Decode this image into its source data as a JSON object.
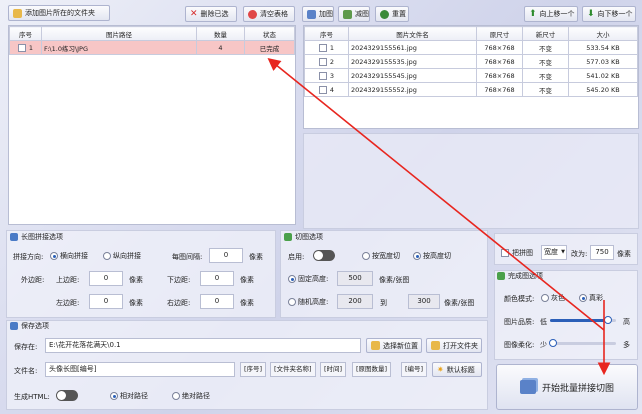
{
  "toolbar": {
    "add_folder": "添加图片所在的文件夹",
    "delete_selected": "删除已选",
    "clear_table": "清空表格",
    "add_image": "加图",
    "remove_image": "减图",
    "reset": "重置",
    "move_up": "向上移一个",
    "move_down": "向下移一个"
  },
  "left_table": {
    "headers": [
      "序号",
      "图片路径",
      "数量",
      "状态"
    ],
    "rows": [
      {
        "index": "1",
        "path": "F:\\1.0练习\\JPG",
        "count": "4",
        "status": "已完成"
      }
    ]
  },
  "right_table": {
    "headers": [
      "序号",
      "图片文件名",
      "原尺寸",
      "新尺寸",
      "大小"
    ],
    "rows": [
      {
        "index": "1",
        "name": "2024329155561.jpg",
        "orig": "768×768",
        "new": "不变",
        "size": "533.54 KB"
      },
      {
        "index": "2",
        "name": "2024329155535.jpg",
        "orig": "768×768",
        "new": "不变",
        "size": "577.03 KB"
      },
      {
        "index": "3",
        "name": "2024329155545.jpg",
        "orig": "768×768",
        "new": "不变",
        "size": "541.02 KB"
      },
      {
        "index": "4",
        "name": "2024329155552.jpg",
        "orig": "768×768",
        "new": "不变",
        "size": "545.20 KB"
      }
    ]
  },
  "stitch": {
    "title": "长图拼接选项",
    "direction_label": "拼接方向:",
    "horizontal": "横向拼接",
    "vertical": "纵向拼接",
    "gap_label": "每图间隔:",
    "gap_value": "0",
    "px": "像素",
    "margin_label": "外边距:",
    "top_label": "上边距:",
    "top_value": "0",
    "bottom_label": "下边距:",
    "bottom_value": "0",
    "left_label": "左边距:",
    "left_value": "0",
    "right_label": "右边距:",
    "right_value": "0"
  },
  "cut": {
    "title": "切图选项",
    "enable_label": "启用:",
    "by_width": "按宽度切",
    "by_height": "按高度切",
    "fixed_height": "固定高度:",
    "fixed_value": "500",
    "unit": "像素/张图",
    "random_height": "随机高度:",
    "random_from": "200",
    "to": "到",
    "random_to": "300"
  },
  "resize": {
    "label": "把拼图",
    "select": "宽度",
    "change_to": "改为:",
    "value": "750",
    "px": "像素"
  },
  "finish": {
    "title": "完成图选项",
    "color_label": "颜色模式:",
    "grey": "灰色",
    "color": "真彩",
    "quality_label": "图片品质:",
    "low": "低",
    "high": "高",
    "quality_level": 0.88,
    "soften_label": "图像柔化:",
    "less": "少",
    "more": "多",
    "soften_level": 0.0
  },
  "save": {
    "title": "保存选项",
    "save_to_label": "保存在:",
    "save_path": "E:\\花开花落花满天\\0.1",
    "choose_button": "选择新位置",
    "open_folder_button": "打开文件夹",
    "filename_label": "文件名:",
    "filename_value": "头像长图[编号]",
    "tags": [
      "[序号]",
      "[文件夹名称]",
      "[时间]",
      "[原图数量]",
      "[编号]"
    ],
    "default_button": "默认标题",
    "html_label": "生成HTML:",
    "relative": "相对路径",
    "absolute": "绝对路径"
  },
  "start_button": "开始批量拼接切图",
  "colors": {
    "arrow": "#e8261f",
    "selected_row": "#f7c6c6",
    "accent": "#2b5fb8"
  }
}
